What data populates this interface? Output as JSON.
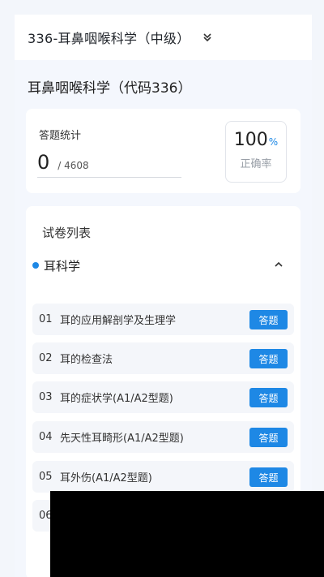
{
  "header": {
    "course_title": "336-耳鼻咽喉科学（中级）"
  },
  "subject": {
    "title": "耳鼻咽喉科学（代码336）"
  },
  "stats": {
    "label": "答题统计",
    "answered": "0",
    "total": "/ 4608",
    "accuracy_value": "100",
    "accuracy_unit": "%",
    "accuracy_label": "正确率"
  },
  "paper_list": {
    "title": "试卷列表",
    "section": {
      "label": "耳科学"
    },
    "items": [
      {
        "num": "01",
        "name": "耳的应用解剖学及生理学",
        "action": "答题"
      },
      {
        "num": "02",
        "name": "耳的检查法",
        "action": "答题"
      },
      {
        "num": "03",
        "name": "耳的症状学(A1/A2型题)",
        "action": "答题"
      },
      {
        "num": "04",
        "name": "先天性耳畸形(A1/A2型题)",
        "action": "答题"
      },
      {
        "num": "05",
        "name": "耳外伤(A1/A2型题)",
        "action": "答题"
      },
      {
        "num": "06",
        "name": "",
        "action": ""
      }
    ]
  },
  "colors": {
    "accent": "#1e88e5",
    "background": "#f4f7fd",
    "card": "#ffffff"
  },
  "icons": {
    "course_switch": "chevron-double-down-icon",
    "section_toggle": "chevron-up-icon"
  }
}
